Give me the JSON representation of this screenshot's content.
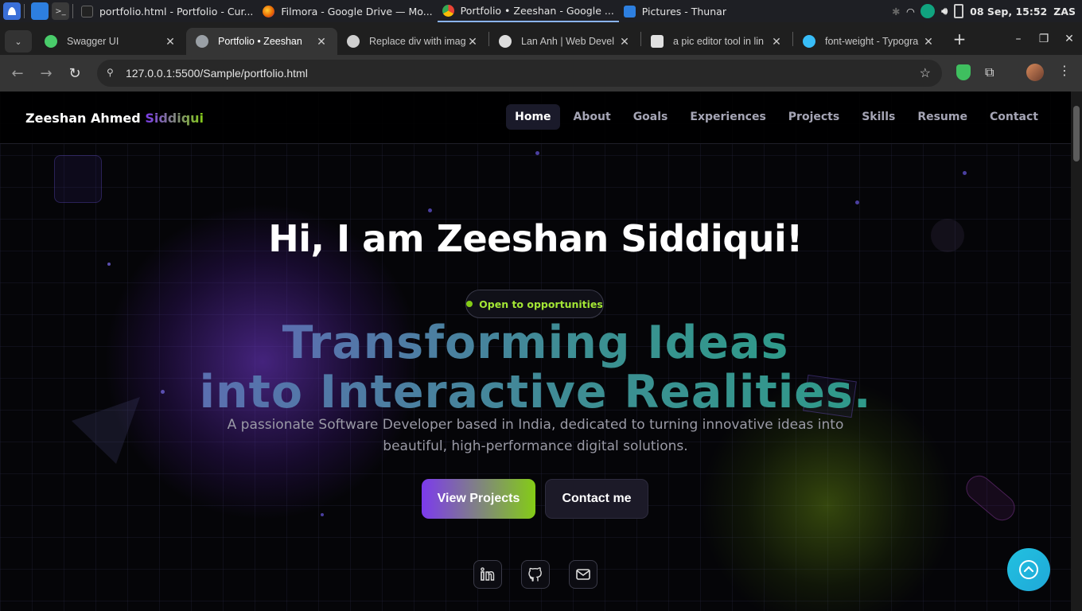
{
  "taskbar": {
    "windows": [
      {
        "title": "portfolio.html - Portfolio - Cur...",
        "icon": "cursor-icon"
      },
      {
        "title": "Filmora - Google Drive — Mo...",
        "icon": "firefox-icon"
      },
      {
        "title": "Portfolio • Zeeshan - Google ...",
        "icon": "chrome-icon"
      },
      {
        "title": "Pictures - Thunar",
        "icon": "folder-icon"
      }
    ],
    "clock": "08 Sep, 15:52",
    "user": "ZAS"
  },
  "tabs": [
    {
      "title": "Swagger UI",
      "icon": "swagger-icon",
      "color": "#49cc6a"
    },
    {
      "title": "Portfolio • Zeeshan",
      "icon": "globe-icon",
      "color": "#9aa0a6"
    },
    {
      "title": "Replace div with imag",
      "icon": "openai-icon",
      "color": "#cfcfcf"
    },
    {
      "title": "Lan Anh | Web Devel",
      "icon": "star-logo-icon",
      "color": "#ffffff"
    },
    {
      "title": "a pic editor tool in lin",
      "icon": "github-copilot-icon",
      "color": "#e0e0e0"
    },
    {
      "title": "font-weight - Typogra",
      "icon": "tailwind-icon",
      "color": "#38bdf8"
    }
  ],
  "address": {
    "url": "127.0.0.1:5500/Sample/portfolio.html"
  },
  "site": {
    "brand_first": "Zeeshan Ahmed",
    "brand_last": "Siddiqui",
    "nav": [
      "Home",
      "About",
      "Goals",
      "Experiences",
      "Projects",
      "Skills",
      "Resume",
      "Contact"
    ],
    "greeting": "Hi, I am Zeeshan Siddiqui!",
    "badge": "Open to opportunities",
    "headline_line1": "Transforming Ideas",
    "headline_line2": "into Interactive Realities.",
    "subtitle": "A passionate Software Developer based in India, dedicated to turning innovative ideas into beautiful, high-performance digital solutions.",
    "btn_primary": "View Projects",
    "btn_secondary": "Contact me",
    "socials": [
      "linkedin-icon",
      "github-icon",
      "mail-icon"
    ]
  },
  "colors": {
    "accent_purple": "#7c3aed",
    "accent_lime": "#84cc16",
    "to_top": "#22c1e0"
  }
}
